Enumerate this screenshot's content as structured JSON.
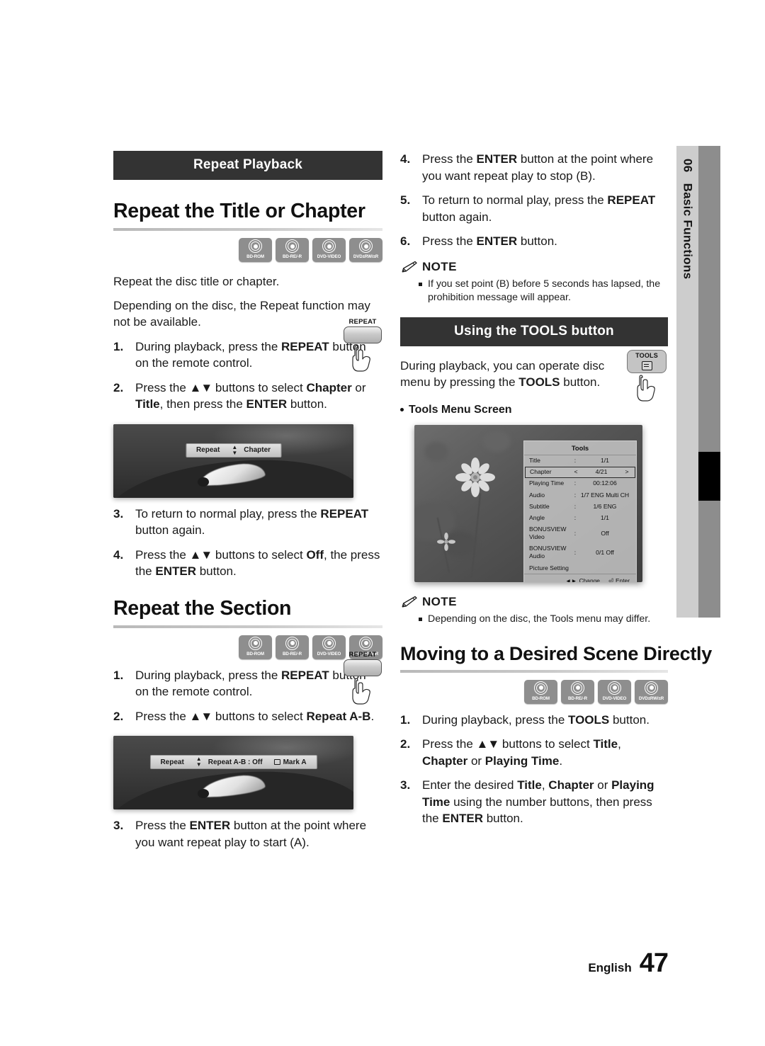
{
  "page": {
    "language": "English",
    "number": "47",
    "side_tab_number": "06",
    "side_tab_label": "Basic Functions"
  },
  "left_column": {
    "section_bar": "Repeat Playback",
    "heading_1": "Repeat the Title or Chapter",
    "disc_icons_1": [
      "BD-ROM",
      "BD-RE/-R",
      "DVD-VIDEO",
      "DVD±RW/±R"
    ],
    "intro_line_1": "Repeat the disc title or chapter.",
    "intro_line_2": "Depending on the disc, the Repeat function may not be available.",
    "steps_1": [
      {
        "num": "1.",
        "parts": [
          {
            "t": "During playback, press the ",
            "b": false
          },
          {
            "t": "REPEAT",
            "b": true
          },
          {
            "t": " button on the remote control.",
            "b": false
          }
        ]
      },
      {
        "num": "2.",
        "parts": [
          {
            "t": "Press the ",
            "b": false
          },
          {
            "t": "▲▼",
            "b": false,
            "arrows": true
          },
          {
            "t": " buttons to select ",
            "b": false
          },
          {
            "t": "Chapter",
            "b": true
          },
          {
            "t": " or ",
            "b": false
          },
          {
            "t": "Title",
            "b": true
          },
          {
            "t": ", then press the ",
            "b": false
          },
          {
            "t": "ENTER",
            "b": true
          },
          {
            "t": " button.",
            "b": false
          }
        ]
      }
    ],
    "screen_1": {
      "label": "Repeat",
      "value": "Chapter"
    },
    "steps_2": [
      {
        "num": "3.",
        "parts": [
          {
            "t": "To return to normal play, press the ",
            "b": false
          },
          {
            "t": "REPEAT",
            "b": true
          },
          {
            "t": " button again.",
            "b": false
          }
        ]
      },
      {
        "num": "4.",
        "parts": [
          {
            "t": "Press the ",
            "b": false
          },
          {
            "t": "▲▼",
            "b": false,
            "arrows": true
          },
          {
            "t": " buttons to select ",
            "b": false
          },
          {
            "t": "Off",
            "b": true
          },
          {
            "t": ", the press the ",
            "b": false
          },
          {
            "t": "ENTER",
            "b": true
          },
          {
            "t": " button.",
            "b": false
          }
        ]
      }
    ],
    "heading_2": "Repeat the Section",
    "disc_icons_2": [
      "BD-ROM",
      "BD-RE/-R",
      "DVD-VIDEO",
      "DVD±RW/±R"
    ],
    "steps_3": [
      {
        "num": "1.",
        "parts": [
          {
            "t": "During playback, press the ",
            "b": false
          },
          {
            "t": "REPEAT",
            "b": true
          },
          {
            "t": " button on the remote control.",
            "b": false
          }
        ]
      },
      {
        "num": "2.",
        "parts": [
          {
            "t": "Press the ",
            "b": false
          },
          {
            "t": "▲▼",
            "b": false,
            "arrows": true
          },
          {
            "t": " buttons to select ",
            "b": false
          },
          {
            "t": "Repeat A-B",
            "b": true
          },
          {
            "t": ".",
            "b": false
          }
        ]
      }
    ],
    "screen_2": {
      "label": "Repeat",
      "value": "Repeat A-B : Off",
      "action": "Mark A"
    },
    "steps_4": [
      {
        "num": "3.",
        "parts": [
          {
            "t": "Press the ",
            "b": false
          },
          {
            "t": "ENTER",
            "b": true
          },
          {
            "t": " button at the point where you want repeat play to start (A).",
            "b": false
          }
        ]
      }
    ],
    "key_repeat_caption": "REPEAT"
  },
  "right_column": {
    "steps_top": [
      {
        "num": "4.",
        "parts": [
          {
            "t": "Press the ",
            "b": false
          },
          {
            "t": "ENTER",
            "b": true
          },
          {
            "t": " button at the point where you want repeat play to stop (B).",
            "b": false
          }
        ]
      },
      {
        "num": "5.",
        "parts": [
          {
            "t": "To return to normal play, press the ",
            "b": false
          },
          {
            "t": "REPEAT",
            "b": true
          },
          {
            "t": " button again.",
            "b": false
          }
        ]
      },
      {
        "num": "6.",
        "parts": [
          {
            "t": "Press the ",
            "b": false
          },
          {
            "t": "ENTER",
            "b": true
          },
          {
            "t": " button.",
            "b": false
          }
        ]
      }
    ],
    "note_1": {
      "title": "NOTE",
      "items": [
        "If you set point (B) before 5 seconds has lapsed, the prohibition message will appear."
      ]
    },
    "section_bar": "Using the TOOLS button",
    "tools_intro": [
      {
        "t": "During playback, you can operate disc menu by pressing the ",
        "b": false
      },
      {
        "t": "TOOLS",
        "b": true
      },
      {
        "t": " button.",
        "b": false
      }
    ],
    "key_tools_caption": "TOOLS",
    "tools_menu_screen_label": "Tools Menu Screen",
    "tools_menu": {
      "title": "Tools",
      "rows": [
        {
          "key": "Title",
          "sep": ":",
          "value": "1/1",
          "selected": false
        },
        {
          "key": "Chapter",
          "sep": "<",
          "value": "4/21",
          "right": ">",
          "selected": true
        },
        {
          "key": "Playing Time",
          "sep": ":",
          "value": "00:12:06",
          "selected": false
        },
        {
          "key": "Audio",
          "sep": ":",
          "value": "1/7 ENG Multi CH",
          "selected": false
        },
        {
          "key": "Subtitle",
          "sep": ":",
          "value": "1/6 ENG",
          "selected": false
        },
        {
          "key": "Angle",
          "sep": ":",
          "value": "1/1",
          "selected": false
        },
        {
          "key": "BONUSVIEW Video",
          "sep": ":",
          "value": "Off",
          "selected": false
        },
        {
          "key": "BONUSVIEW Audio",
          "sep": ":",
          "value": "0/1 Off",
          "selected": false
        },
        {
          "key": "Picture Setting",
          "sep": "",
          "value": "",
          "selected": false
        }
      ],
      "footer": {
        "change": "Change",
        "enter": "Enter"
      }
    },
    "note_2": {
      "title": "NOTE",
      "items": [
        "Depending on the disc, the Tools menu may differ."
      ]
    },
    "heading": "Moving to a Desired Scene Directly",
    "disc_icons": [
      "BD-ROM",
      "BD-RE/-R",
      "DVD-VIDEO",
      "DVD±RW/±R"
    ],
    "steps_bottom": [
      {
        "num": "1.",
        "parts": [
          {
            "t": "During playback, press the ",
            "b": false
          },
          {
            "t": "TOOLS",
            "b": true
          },
          {
            "t": " button.",
            "b": false
          }
        ]
      },
      {
        "num": "2.",
        "parts": [
          {
            "t": "Press the ",
            "b": false
          },
          {
            "t": "▲▼",
            "b": false,
            "arrows": true
          },
          {
            "t": " buttons to select ",
            "b": false
          },
          {
            "t": "Title",
            "b": true
          },
          {
            "t": ", ",
            "b": false
          },
          {
            "t": "Chapter",
            "b": true
          },
          {
            "t": " or ",
            "b": false
          },
          {
            "t": "Playing Time",
            "b": true
          },
          {
            "t": ".",
            "b": false
          }
        ]
      },
      {
        "num": "3.",
        "parts": [
          {
            "t": "Enter the desired ",
            "b": false
          },
          {
            "t": "Title",
            "b": true
          },
          {
            "t": ", ",
            "b": false
          },
          {
            "t": "Chapter",
            "b": true
          },
          {
            "t": " or ",
            "b": false
          },
          {
            "t": "Playing Time",
            "b": true
          },
          {
            "t": " using the number buttons, then press the ",
            "b": false
          },
          {
            "t": "ENTER",
            "b": true
          },
          {
            "t": " button.",
            "b": false
          }
        ]
      }
    ]
  },
  "colors": {
    "bar_bg": "#333333",
    "disc_icon_bg": "#8e8e8e",
    "side_tab_light": "#cdcdcd",
    "side_tab_dark": "#8d8d8d"
  }
}
